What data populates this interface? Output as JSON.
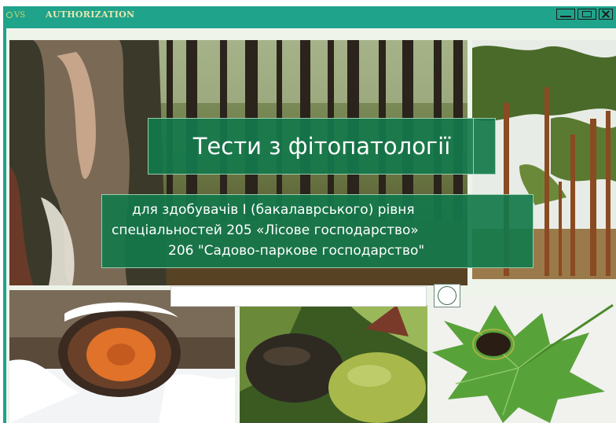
{
  "window": {
    "logo_text": "VS",
    "title": "AUTHORIZATION"
  },
  "banner": {
    "title": "Тести з фітопатології",
    "subtitle_line1": "для здобувачів I (бакалаврського) рівня",
    "subtitle_line2": "спеціальностей 205 «Лісове господарство»",
    "subtitle_line3": "206 \"Садово-паркове господарство\""
  },
  "login": {
    "input_value": "",
    "input_placeholder": ""
  },
  "icons": {
    "logo": "ring-logo-icon",
    "minimize": "minimize-icon",
    "maximize": "maximize-icon",
    "close": "close-icon",
    "login_button": "circle-icon"
  },
  "colors": {
    "titlebar": "#1fa38b",
    "banner": "#14784b",
    "title_text": "#e9e8b0"
  }
}
